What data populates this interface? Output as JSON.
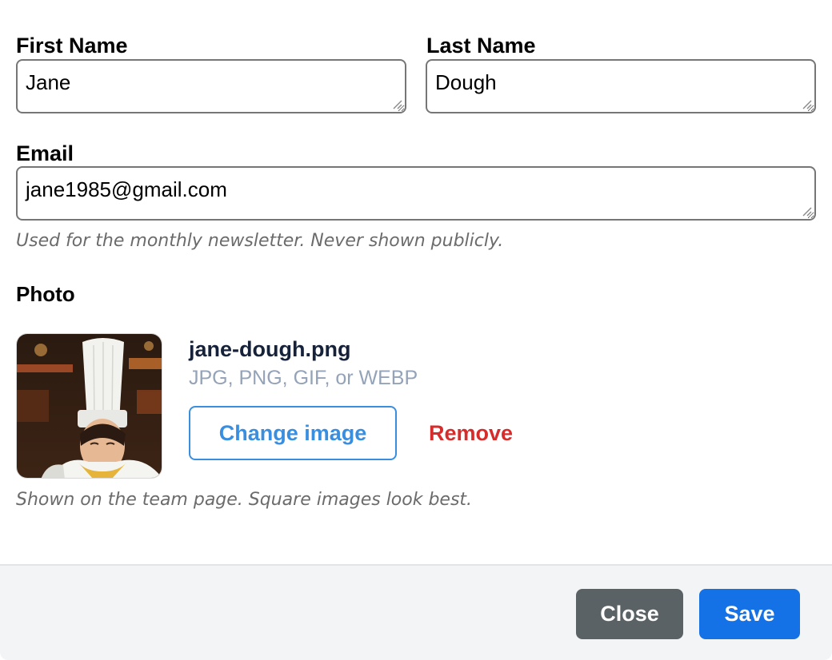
{
  "form": {
    "first_name": {
      "label": "First Name",
      "value": "Jane"
    },
    "last_name": {
      "label": "Last Name",
      "value": "Dough"
    },
    "email": {
      "label": "Email",
      "value": "jane1985@gmail.com",
      "hint": "Used for the monthly newsletter. Never shown publicly."
    },
    "photo": {
      "label": "Photo",
      "file_name": "jane-dough.png",
      "file_types": "JPG, PNG, GIF, or WEBP",
      "change_label": "Change image",
      "remove_label": "Remove",
      "hint": "Shown on the team page. Square images look best."
    }
  },
  "footer": {
    "close_label": "Close",
    "save_label": "Save"
  },
  "colors": {
    "primary": "#1471e6",
    "secondary": "#5b6266",
    "link": "#3a8ee0",
    "danger": "#d62c2c"
  }
}
